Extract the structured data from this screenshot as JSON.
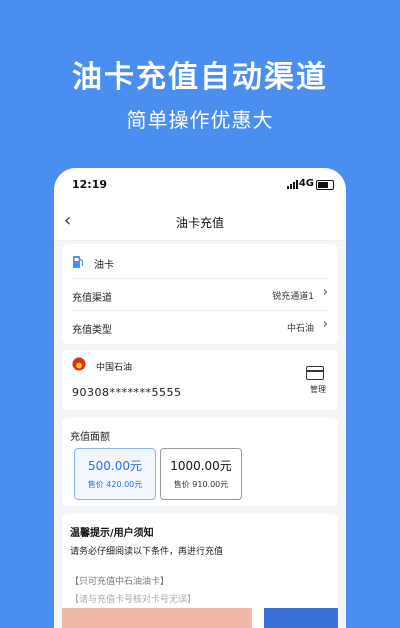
{
  "promo": {
    "title": "油卡充值自动渠道",
    "subtitle": "简单操作优惠大"
  },
  "status_bar": {
    "time": "12:19",
    "network": "4G"
  },
  "nav": {
    "title": "油卡充值"
  },
  "recharge": {
    "section_label": "油卡",
    "rows": [
      {
        "label": "充值渠道",
        "value": "锐充通道1"
      },
      {
        "label": "充值类型",
        "value": "中石油"
      }
    ]
  },
  "card": {
    "brand": "中国石油",
    "number": "90308*******5555",
    "manage_label": "管理"
  },
  "amounts": {
    "title": "充值面额",
    "options": [
      {
        "value": "500.00元",
        "price": "售价 420.00元"
      },
      {
        "value": "1000.00元",
        "price": "售价 910.00元"
      }
    ]
  },
  "notice": {
    "title": "温馨提示/用户须知",
    "text": "请务必仔细阅读以下条件，再进行充值",
    "item1": "【只可充值中石油油卡】",
    "item2": "【请与充值卡号核对卡号无误】"
  },
  "colors": {
    "background": "#4a8ef0",
    "accent": "#2f6fe0"
  }
}
